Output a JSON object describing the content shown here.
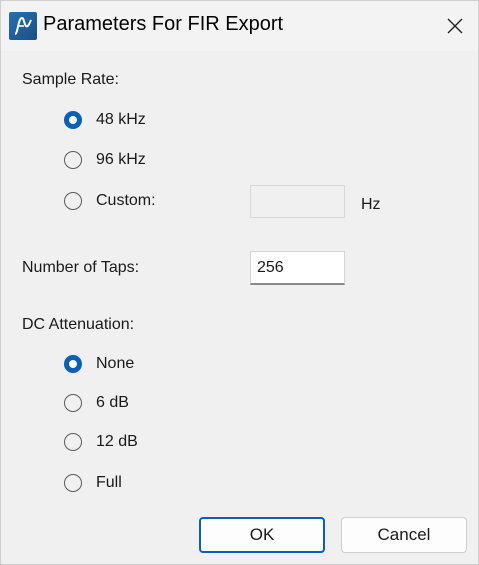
{
  "window": {
    "title": "Parameters For FIR Export",
    "app_icon": "fir-app-icon",
    "close_icon": "close-icon"
  },
  "sample_rate": {
    "label": "Sample Rate:",
    "options": [
      {
        "label": "48 kHz",
        "checked": true
      },
      {
        "label": "96 kHz",
        "checked": false
      },
      {
        "label": "Custom:",
        "checked": false
      }
    ],
    "custom_value": "",
    "custom_unit": "Hz"
  },
  "taps": {
    "label": "Number of Taps:",
    "value": "256"
  },
  "dc_attenuation": {
    "label": "DC Attenuation:",
    "options": [
      {
        "label": "None",
        "checked": true
      },
      {
        "label": "6 dB",
        "checked": false
      },
      {
        "label": "12 dB",
        "checked": false
      },
      {
        "label": "Full",
        "checked": false
      }
    ]
  },
  "buttons": {
    "ok": "OK",
    "cancel": "Cancel"
  },
  "colors": {
    "accent": "#0a5fb6",
    "window_bg": "#f0f0f0"
  }
}
